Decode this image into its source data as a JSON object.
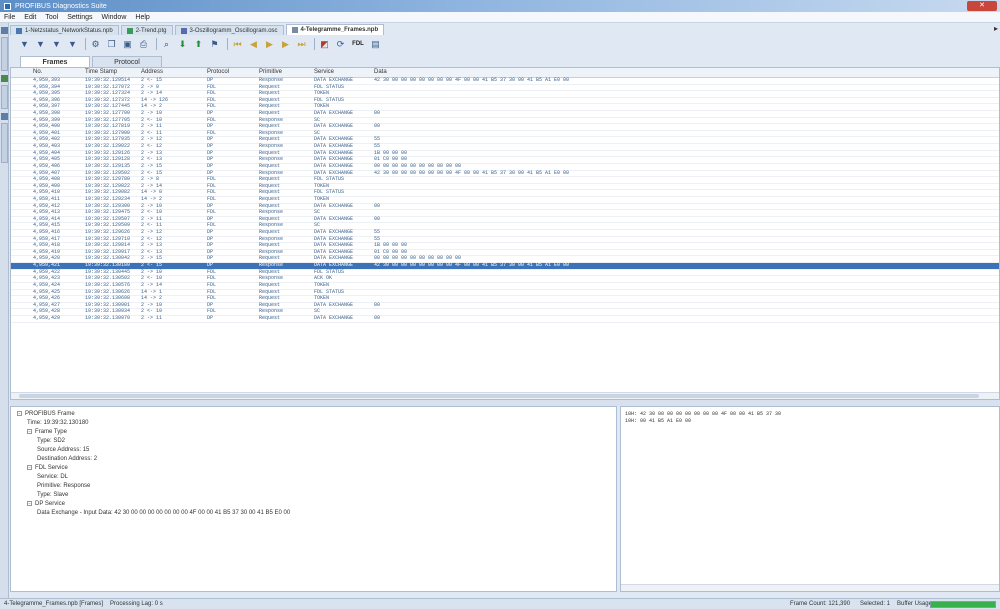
{
  "app": {
    "title": "PROFIBUS Diagnostics Suite",
    "close_label": "✕"
  },
  "menu": [
    "File",
    "Edit",
    "Tool",
    "Settings",
    "Window",
    "Help"
  ],
  "doc_tabs": [
    {
      "label": "1-Netzstatus_NetworkStatus.npb",
      "active": false
    },
    {
      "label": "2-Trend.ptg",
      "active": false
    },
    {
      "label": "3-Oszillogramm_Oscillogram.osc",
      "active": false
    },
    {
      "label": "4-Telegramme_Frames.npb",
      "active": true
    }
  ],
  "toolbar_icons": [
    "filter-icon",
    "filter2-icon",
    "filter3-icon",
    "filter4-icon",
    "settings-icon",
    "copy-icon",
    "save-icon",
    "print-icon",
    "find-icon",
    "down-icon",
    "up-icon",
    "marker-icon",
    "first-icon",
    "prev-icon",
    "play-icon",
    "next-icon",
    "last-icon",
    "capture-icon",
    "refresh-icon",
    "fdl-icon",
    "export-icon"
  ],
  "toolbar_fdl_label": "FDL",
  "view_tabs": [
    {
      "label": "Frames",
      "active": true
    },
    {
      "label": "Protocol",
      "active": false
    }
  ],
  "columns": [
    "No.",
    "Time Stamp",
    "Address",
    "Protocol",
    "Primitive",
    "Service",
    "Data"
  ],
  "rows": [
    [
      "4,959,393",
      "19:39:32.129514",
      "2 <- 15",
      "DP",
      "Response",
      "DATA EXCHANGE",
      "42 30 00 00 00 00 00 00 00 4F 00 00 41 B5 37 30 00 41 B5 A1 E0 00"
    ],
    [
      "4,959,394",
      "19:39:32.127072",
      "2 -> 0",
      "FDL",
      "Request",
      "FDL STATUS",
      ""
    ],
    [
      "4,959,395",
      "19:39:32.127324",
      "2 -> 14",
      "FDL",
      "Request",
      "TOKEN",
      ""
    ],
    [
      "4,959,396",
      "19:39:32.127372",
      "14 -> 126",
      "FDL",
      "Request",
      "FDL STATUS",
      ""
    ],
    [
      "4,959,397",
      "19:39:32.127445",
      "14 -> 2",
      "FDL",
      "Request",
      "TOKEN",
      ""
    ],
    [
      "4,959,398",
      "19:39:32.127700",
      "2 -> 10",
      "DP",
      "Request",
      "DATA EXCHANGE",
      "00"
    ],
    [
      "4,959,399",
      "19:39:32.127705",
      "2 <- 10",
      "FDL",
      "Response",
      "SC",
      ""
    ],
    [
      "4,959,400",
      "19:39:32.127819",
      "2 -> 11",
      "DP",
      "Request",
      "DATA EXCHANGE",
      "00"
    ],
    [
      "4,959,401",
      "19:39:32.127900",
      "2 <- 11",
      "FDL",
      "Response",
      "SC",
      ""
    ],
    [
      "4,959,402",
      "19:39:32.127935",
      "2 -> 12",
      "DP",
      "Request",
      "DATA EXCHANGE",
      "55"
    ],
    [
      "4,959,403",
      "19:39:32.129022",
      "2 <- 12",
      "DP",
      "Response",
      "DATA EXCHANGE",
      "55"
    ],
    [
      "4,959,404",
      "19:39:32.129126",
      "2 -> 13",
      "DP",
      "Request",
      "DATA EXCHANGE",
      "1B 00 00 00"
    ],
    [
      "4,959,405",
      "19:39:32.129128",
      "2 <- 13",
      "DP",
      "Response",
      "DATA EXCHANGE",
      "01 C0 00 00"
    ],
    [
      "4,959,406",
      "19:39:32.129135",
      "2 -> 15",
      "DP",
      "Request",
      "DATA EXCHANGE",
      "00 00 00 00 00 00 00 00 00 00"
    ],
    [
      "4,959,407",
      "19:39:32.129502",
      "2 <- 15",
      "DP",
      "Response",
      "DATA EXCHANGE",
      "42 30 00 00 00 00 00 00 00 4F 00 00 41 B5 37 30 00 41 B5 A1 E0 00"
    ],
    [
      "4,959,408",
      "19:39:32.129780",
      "2 -> 8",
      "FDL",
      "Request",
      "FDL STATUS",
      ""
    ],
    [
      "4,959,409",
      "19:39:32.129822",
      "2 -> 14",
      "FDL",
      "Request",
      "TOKEN",
      ""
    ],
    [
      "4,959,410",
      "19:39:32.129082",
      "14 -> 0",
      "FDL",
      "Request",
      "FDL STATUS",
      ""
    ],
    [
      "4,959,411",
      "19:39:32.129234",
      "14 -> 2",
      "FDL",
      "Request",
      "TOKEN",
      ""
    ],
    [
      "4,959,412",
      "19:39:32.129300",
      "2 -> 10",
      "DP",
      "Request",
      "DATA EXCHANGE",
      "00"
    ],
    [
      "4,959,413",
      "19:39:32.129475",
      "2 <- 10",
      "FDL",
      "Response",
      "SC",
      ""
    ],
    [
      "4,959,414",
      "19:39:32.129507",
      "2 -> 11",
      "DP",
      "Request",
      "DATA EXCHANGE",
      "00"
    ],
    [
      "4,959,415",
      "19:39:32.129509",
      "2 <- 11",
      "FDL",
      "Response",
      "SC",
      ""
    ],
    [
      "4,959,416",
      "19:39:32.129626",
      "2 -> 12",
      "DP",
      "Request",
      "DATA EXCHANGE",
      "55"
    ],
    [
      "4,959,417",
      "19:39:32.129710",
      "2 <- 12",
      "DP",
      "Response",
      "DATA EXCHANGE",
      "55"
    ],
    [
      "4,959,418",
      "19:39:32.129814",
      "2 -> 13",
      "DP",
      "Request",
      "DATA EXCHANGE",
      "1B 00 00 00"
    ],
    [
      "4,959,419",
      "19:39:32.129917",
      "2 <- 13",
      "DP",
      "Response",
      "DATA EXCHANGE",
      "01 C0 00 00"
    ],
    [
      "4,959,420",
      "19:39:32.130042",
      "2 -> 15",
      "DP",
      "Request",
      "DATA EXCHANGE",
      "00 00 00 00 00 00 00 00 00 00"
    ],
    [
      "4,959,421",
      "19:39:32.130180",
      "2 <- 15",
      "DP",
      "Response",
      "DATA EXCHANGE",
      "42 30 00 00 00 00 00 00 00 4F 00 00 41 B5 37 30 00 41 B5 A1 E0 00"
    ],
    [
      "4,959,422",
      "19:39:32.130445",
      "2 -> 10",
      "FDL",
      "Request",
      "FDL STATUS",
      ""
    ],
    [
      "4,959,423",
      "19:39:32.130502",
      "2 <- 10",
      "FDL",
      "Response",
      "ACK OK",
      ""
    ],
    [
      "4,959,424",
      "19:39:32.130576",
      "2 -> 14",
      "FDL",
      "Request",
      "TOKEN",
      ""
    ],
    [
      "4,959,425",
      "19:39:32.130626",
      "14 -> 1",
      "FDL",
      "Request",
      "FDL STATUS",
      ""
    ],
    [
      "4,959,426",
      "19:39:32.130698",
      "14 -> 2",
      "FDL",
      "Request",
      "TOKEN",
      ""
    ],
    [
      "4,959,427",
      "19:39:32.130901",
      "2 -> 10",
      "DP",
      "Request",
      "DATA EXCHANGE",
      "00"
    ],
    [
      "4,959,428",
      "19:39:32.130934",
      "2 <- 10",
      "FDL",
      "Response",
      "SC",
      ""
    ],
    [
      "4,959,429",
      "19:39:32.130970",
      "2 -> 11",
      "DP",
      "Request",
      "DATA EXCHANGE",
      "00"
    ]
  ],
  "selected_row_index": 28,
  "tree": [
    {
      "level": 0,
      "expander": "−",
      "text": "PROFIBUS Frame"
    },
    {
      "level": 1,
      "expander": "",
      "text": "Time: 19:39:32.130180"
    },
    {
      "level": 1,
      "expander": "−",
      "text": "Frame Type"
    },
    {
      "level": 2,
      "expander": "",
      "text": "Type: SD2"
    },
    {
      "level": 2,
      "expander": "",
      "text": "Source Address: 15"
    },
    {
      "level": 2,
      "expander": "",
      "text": "Destination Address: 2"
    },
    {
      "level": 1,
      "expander": "−",
      "text": "FDL Service"
    },
    {
      "level": 2,
      "expander": "",
      "text": "Service: DL"
    },
    {
      "level": 2,
      "expander": "",
      "text": "Primitive: Response"
    },
    {
      "level": 2,
      "expander": "",
      "text": "Type: Slave"
    },
    {
      "level": 1,
      "expander": "−",
      "text": "DP Service"
    },
    {
      "level": 2,
      "expander": "",
      "text": "Data Exchange - Input Data: 42 30 00 00 00 00 00 00 00 4F 00 00 41 B5 37 30 00 41 B5 E0 00"
    }
  ],
  "hex_lines": [
    "10H:   42 30 00 00 00 00 00 00 00 4F 00 00 41 B5 37 30",
    "10H:   00 41 B5 A1 E0 00"
  ],
  "status": {
    "file": "4-Telegramme_Frames.npb [Frames]",
    "lag": "Processing Lag: 0 s",
    "count": "Frame Count: 121,390",
    "selected": "Selected: 1",
    "buffer_label": "Buffer Usage:",
    "buffer_percent": 100
  },
  "colors": {
    "selected_row": "#3c72b8",
    "buffer_fill": "#35b34a"
  }
}
